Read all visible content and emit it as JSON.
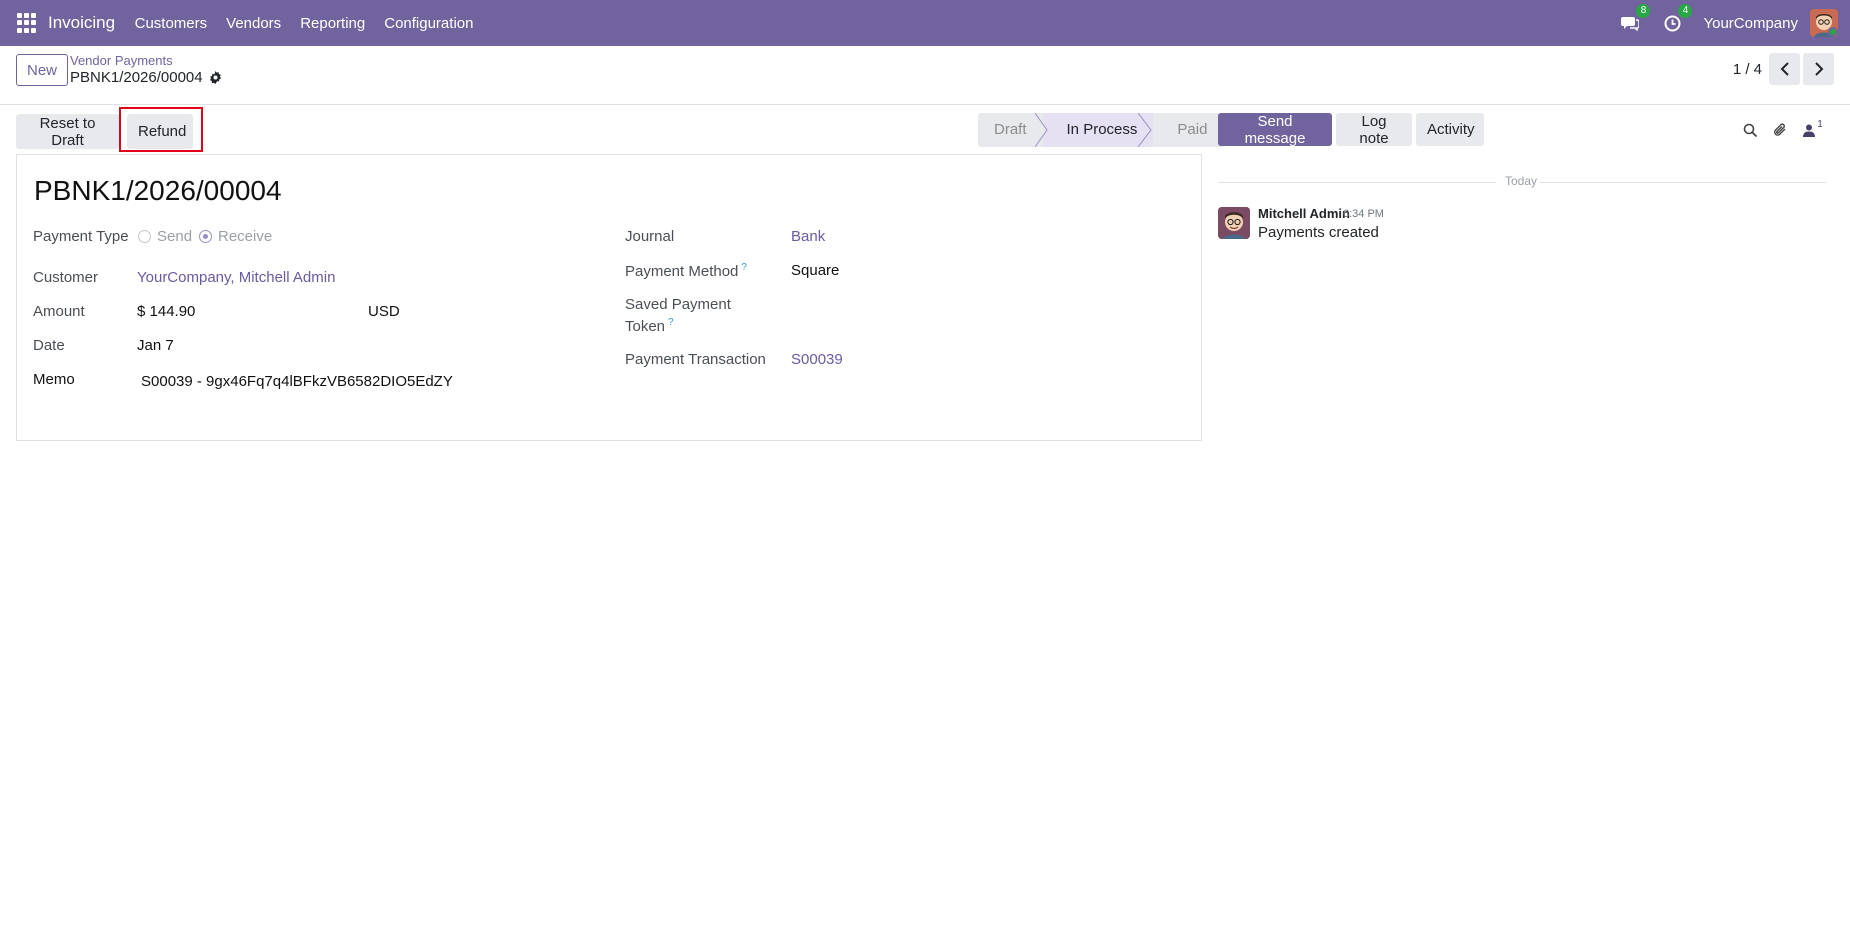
{
  "navbar": {
    "app_name": "Invoicing",
    "menu": [
      "Customers",
      "Vendors",
      "Reporting",
      "Configuration"
    ],
    "messages_count": "8",
    "activities_count": "4",
    "company": "YourCompany",
    "color": "#71639e"
  },
  "control_panel": {
    "new_label": "New",
    "breadcrumb_parent": "Vendor Payments",
    "breadcrumb_current": "PBNK1/2026/00004",
    "pager": "1 / 4"
  },
  "header": {
    "reset_label": "Reset to Draft",
    "refund_label": "Refund",
    "stages": [
      "Draft",
      "In Process",
      "Paid"
    ],
    "active_stage": "In Process"
  },
  "form": {
    "title": "PBNK1/2026/00004",
    "payment_type_label": "Payment Type",
    "payment_type_options": [
      "Send",
      "Receive"
    ],
    "payment_type_selected": "Receive",
    "customer_label": "Customer",
    "customer_value": "YourCompany, Mitchell Admin",
    "amount_label": "Amount",
    "amount_value": "$ 144.90",
    "currency": "USD",
    "date_label": "Date",
    "date_value": "Jan 7",
    "memo_label": "Memo",
    "memo_value": "S00039 - 9gx46Fq7q4lBFkzVB6582DIO5EdZY",
    "journal_label": "Journal",
    "journal_value": "Bank",
    "payment_method_label": "Payment Method",
    "payment_method_value": "Square",
    "saved_token_label_line1": "Saved Payment",
    "saved_token_label_line2": "Token",
    "payment_transaction_label": "Payment Transaction",
    "payment_transaction_value": "S00039",
    "help_mark": "?"
  },
  "chatter": {
    "send_message_label": "Send message",
    "log_note_label": "Log note",
    "activity_label": "Activity",
    "followers_count": "1",
    "date_separator": "Today",
    "messages": [
      {
        "author": "Mitchell Admin",
        "time": "6:34 PM",
        "body": "Payments created"
      }
    ]
  }
}
